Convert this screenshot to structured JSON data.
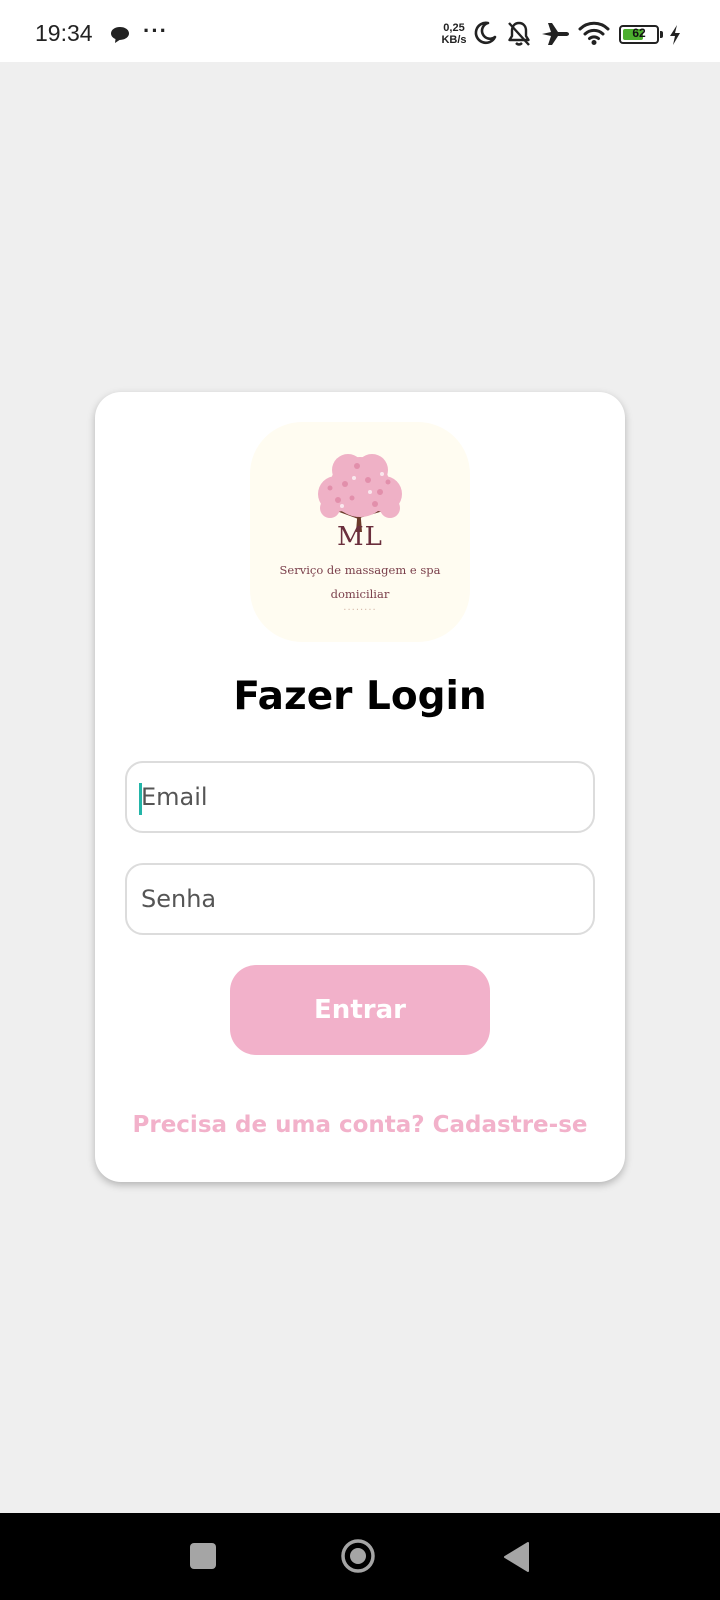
{
  "status_bar": {
    "time": "19:34",
    "more_label": "···",
    "net_speed_value": "0,25",
    "net_speed_unit": "KB/s",
    "battery": {
      "level": "62",
      "fraction": 0.62,
      "color": "#4caf2e"
    },
    "icons": [
      "chat-bubble-icon",
      "moon-icon",
      "bell-off-icon",
      "airplane-icon",
      "wifi-icon",
      "battery-icon",
      "charging-icon"
    ]
  },
  "login": {
    "logo": {
      "initials": "ML",
      "subtitle": "Serviço de massagem e spa domiciliar",
      "dots": "........"
    },
    "title": "Fazer Login",
    "email_placeholder": "Email",
    "password_placeholder": "Senha",
    "submit_label": "Entrar",
    "signup_link": "Precisa de uma conta? Cadastre-se",
    "accent_color": "#f2b1ca"
  },
  "nav_bar": {
    "icons": [
      "recents-icon",
      "home-icon",
      "back-icon"
    ]
  }
}
